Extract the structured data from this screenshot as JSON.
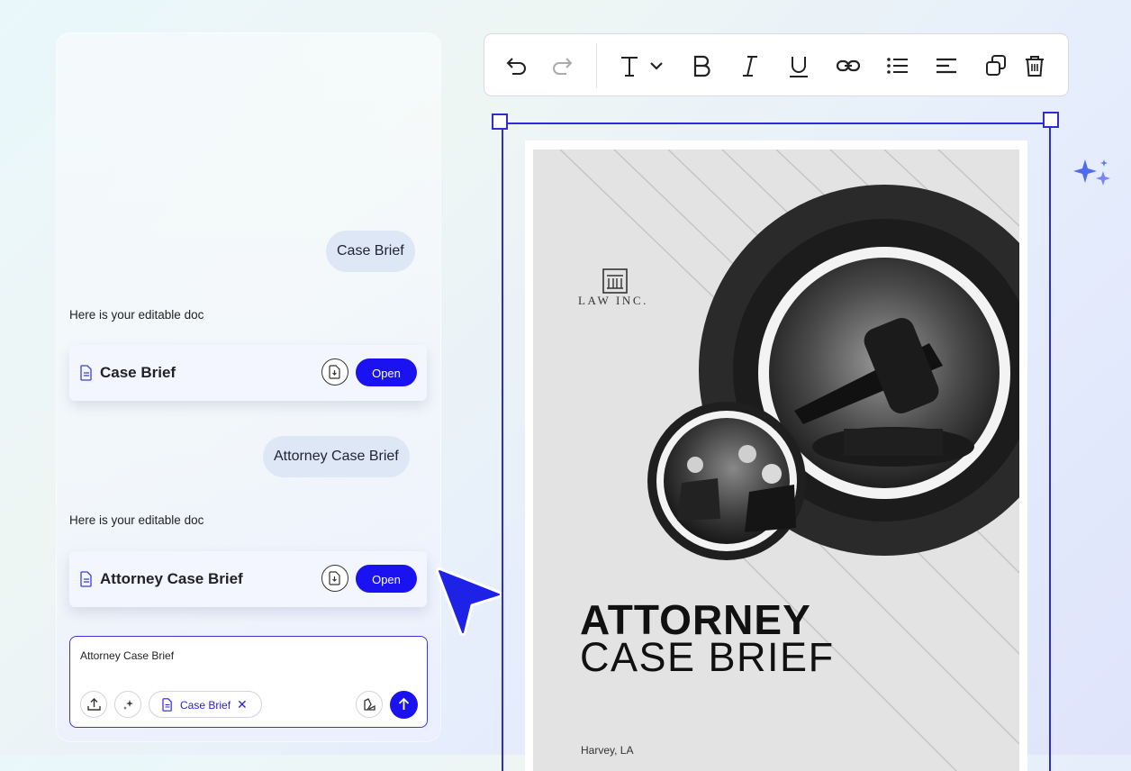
{
  "chat": {
    "messages": [
      {
        "role": "user",
        "text": "Case Brief"
      },
      {
        "role": "assistant",
        "text": "Here is your editable doc",
        "doc_title": "Case Brief",
        "open_label": "Open"
      },
      {
        "role": "user",
        "text": "Attorney Case Brief"
      },
      {
        "role": "assistant",
        "text": "Here is your editable doc",
        "doc_title": "Attorney Case Brief",
        "open_label": "Open"
      }
    ],
    "composer": {
      "value": "Attorney Case Brief",
      "chip_label": "Case Brief",
      "chip_remove": "✕"
    }
  },
  "toolbar": {
    "tools": [
      "undo-icon",
      "redo-icon",
      "text-style-icon",
      "bold-icon",
      "italic-icon",
      "underline-icon",
      "link-icon",
      "bulleted-list-icon",
      "align-left-icon",
      "duplicate-icon",
      "delete-icon"
    ]
  },
  "document": {
    "logo_text": "LAW INC.",
    "title_line1": "ATTORNEY",
    "title_line2": "CASE BRIEF",
    "author": "Harvey, LA"
  },
  "colors": {
    "accent": "#1a12f0",
    "selection": "#2f2bd6",
    "bubble": "#dde7f5",
    "sparkle": "#4f6bf0"
  }
}
